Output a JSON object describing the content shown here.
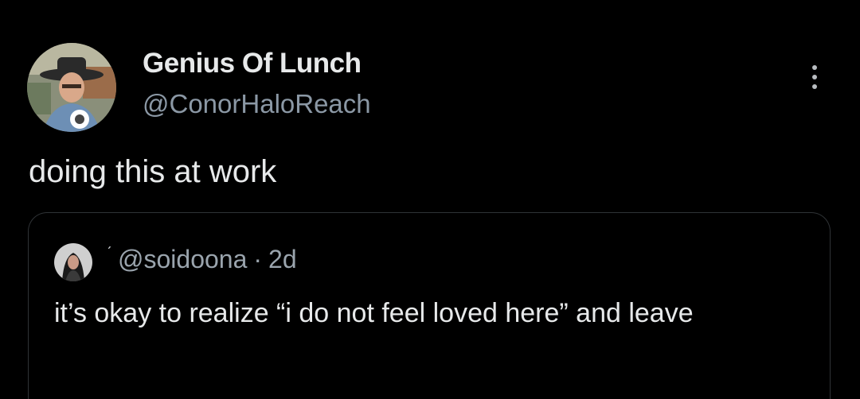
{
  "tweet": {
    "author": {
      "display_name": "Genius Of Lunch",
      "handle": "@ConorHaloReach",
      "avatar_icon": "profile-photo"
    },
    "text": "doing this at work",
    "more_icon": "more-options-icon"
  },
  "quoted_tweet": {
    "handle": "@soidoona",
    "separator": "·",
    "timestamp": "2d",
    "text": "it’s okay to realize “i do not feel loved here” and leave",
    "avatar_icon": "profile-photo"
  },
  "colors": {
    "background": "#000000",
    "primary_text": "#e7e9ea",
    "secondary_text": "#8b98a5",
    "border": "#2f3336"
  }
}
